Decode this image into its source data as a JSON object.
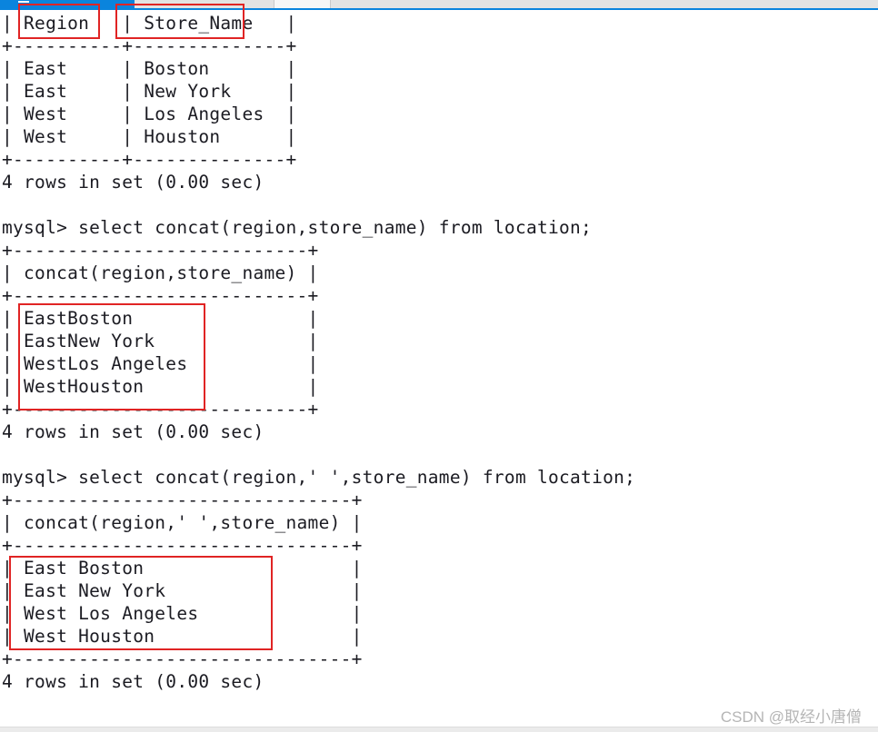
{
  "window": {
    "chrome_color": "#0a84dd",
    "chrome_inactive_color": "#e3e3e3"
  },
  "console": {
    "background": "#ffffff",
    "text_color": "#1b1b22",
    "annotation_color": "#e02424",
    "lines": [
      "| Region   | Store_Name   |",
      "+----------+--------------+",
      "| East     | Boston       |",
      "| East     | New York     |",
      "| West     | Los Angeles  |",
      "| West     | Houston      |",
      "+----------+--------------+",
      "4 rows in set (0.00 sec)",
      "",
      "mysql> select concat(region,store_name) from location;",
      "+---------------------------+",
      "| concat(region,store_name) |",
      "+---------------------------+",
      "| EastBoston                |",
      "| EastNew York              |",
      "| WestLos Angeles           |",
      "| WestHouston               |",
      "+---------------------------+",
      "4 rows in set (0.00 sec)",
      "",
      "mysql> select concat(region,' ',store_name) from location;",
      "+-------------------------------+",
      "| concat(region,' ',store_name) |",
      "+-------------------------------+",
      "| East Boston                   |",
      "| East New York                 |",
      "| West Los Angeles              |",
      "| West Houston                  |",
      "+-------------------------------+",
      "4 rows in set (0.00 sec)"
    ]
  },
  "result_tables": {
    "table_1": {
      "headers": [
        "Region",
        "Store_Name"
      ],
      "rows": [
        [
          "East",
          "Boston"
        ],
        [
          "East",
          "New York"
        ],
        [
          "West",
          "Los Angeles"
        ],
        [
          "West",
          "Houston"
        ]
      ],
      "footer": "4 rows in set (0.00 sec)"
    },
    "table_2": {
      "query": "mysql> select concat(region,store_name) from location;",
      "headers": [
        "concat(region,store_name)"
      ],
      "rows": [
        [
          "EastBoston"
        ],
        [
          "EastNew York"
        ],
        [
          "WestLos Angeles"
        ],
        [
          "WestHouston"
        ]
      ],
      "footer": "4 rows in set (0.00 sec)"
    },
    "table_3": {
      "query": "mysql> select concat(region,' ',store_name) from location;",
      "headers": [
        "concat(region,' ',store_name)"
      ],
      "rows": [
        [
          "East Boston"
        ],
        [
          "East New York"
        ],
        [
          "West Los Angeles"
        ],
        [
          "West Houston"
        ]
      ],
      "footer": "4 rows in set (0.00 sec)"
    }
  },
  "annotations": [
    {
      "name": "region-column-highlight",
      "label": "Region"
    },
    {
      "name": "store-name-column-highlight",
      "label": "Store_Name"
    },
    {
      "name": "concat-no-space-result-highlight",
      "label": "EastBoston / EastNew York / WestLos Angeles / WestHouston"
    },
    {
      "name": "concat-with-space-result-highlight",
      "label": "East Boston / East New York / West Los Angeles / West Houston"
    }
  ],
  "watermark": {
    "text": "CSDN @取经小唐僧"
  }
}
